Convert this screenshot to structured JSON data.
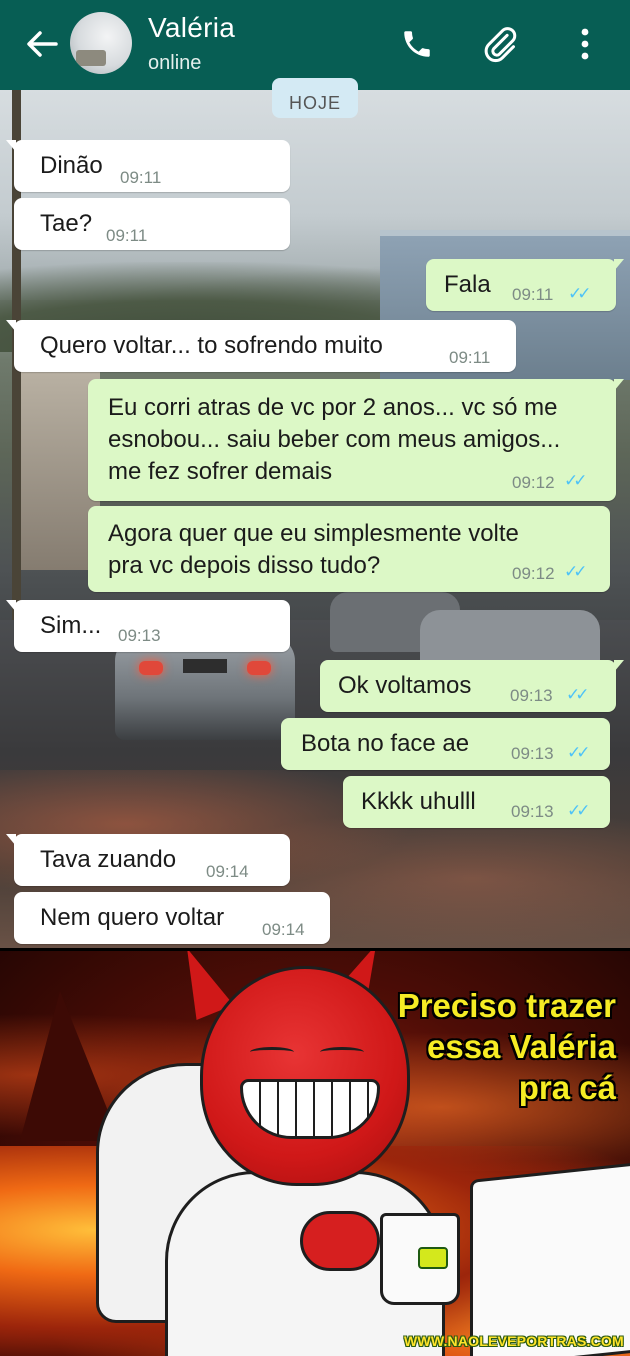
{
  "header": {
    "contact_name": "Valéria",
    "status": "online",
    "icons": [
      "back-arrow-icon",
      "phone-icon",
      "paperclip-icon",
      "more-vert-icon"
    ]
  },
  "date_chip": "HOJE",
  "messages": [
    {
      "direction": "in",
      "text": "Dinão",
      "time": "09:11"
    },
    {
      "direction": "in",
      "text": "Tae?",
      "time": "09:11"
    },
    {
      "direction": "out",
      "text": "Fala",
      "time": "09:11"
    },
    {
      "direction": "in",
      "text": "Quero voltar... to sofrendo muito",
      "time": "09:11"
    },
    {
      "direction": "out",
      "text": "Eu corri atras de vc por 2 anos... vc só me esnobou... saiu beber com meus amigos... me fez sofrer demais",
      "time": "09:12"
    },
    {
      "direction": "out",
      "text": "Agora quer que eu simplesmente volte pra vc depois disso tudo?",
      "time": "09:12"
    },
    {
      "direction": "in",
      "text": "Sim...",
      "time": "09:13"
    },
    {
      "direction": "out",
      "text": "Ok voltamos",
      "time": "09:13"
    },
    {
      "direction": "out",
      "text": "Bota no face ae",
      "time": "09:13"
    },
    {
      "direction": "out",
      "text": "Kkkk uhulll",
      "time": "09:13"
    },
    {
      "direction": "in",
      "text": "Tava zuando",
      "time": "09:14"
    },
    {
      "direction": "in",
      "text": "Nem quero voltar",
      "time": "09:14"
    }
  ],
  "read_receipt": "✓✓",
  "meme": {
    "caption": [
      "Preciso trazer",
      "essa Valéria",
      "pra cá"
    ],
    "watermark": "WWW.NAOLEVEPORTRAS.COM"
  },
  "colors": {
    "header": "#075e54",
    "incoming_bubble": "#ffffff",
    "outgoing_bubble": "#dcf8c6",
    "read_tick": "#4fc3f7",
    "caption": "#f6ec24"
  }
}
